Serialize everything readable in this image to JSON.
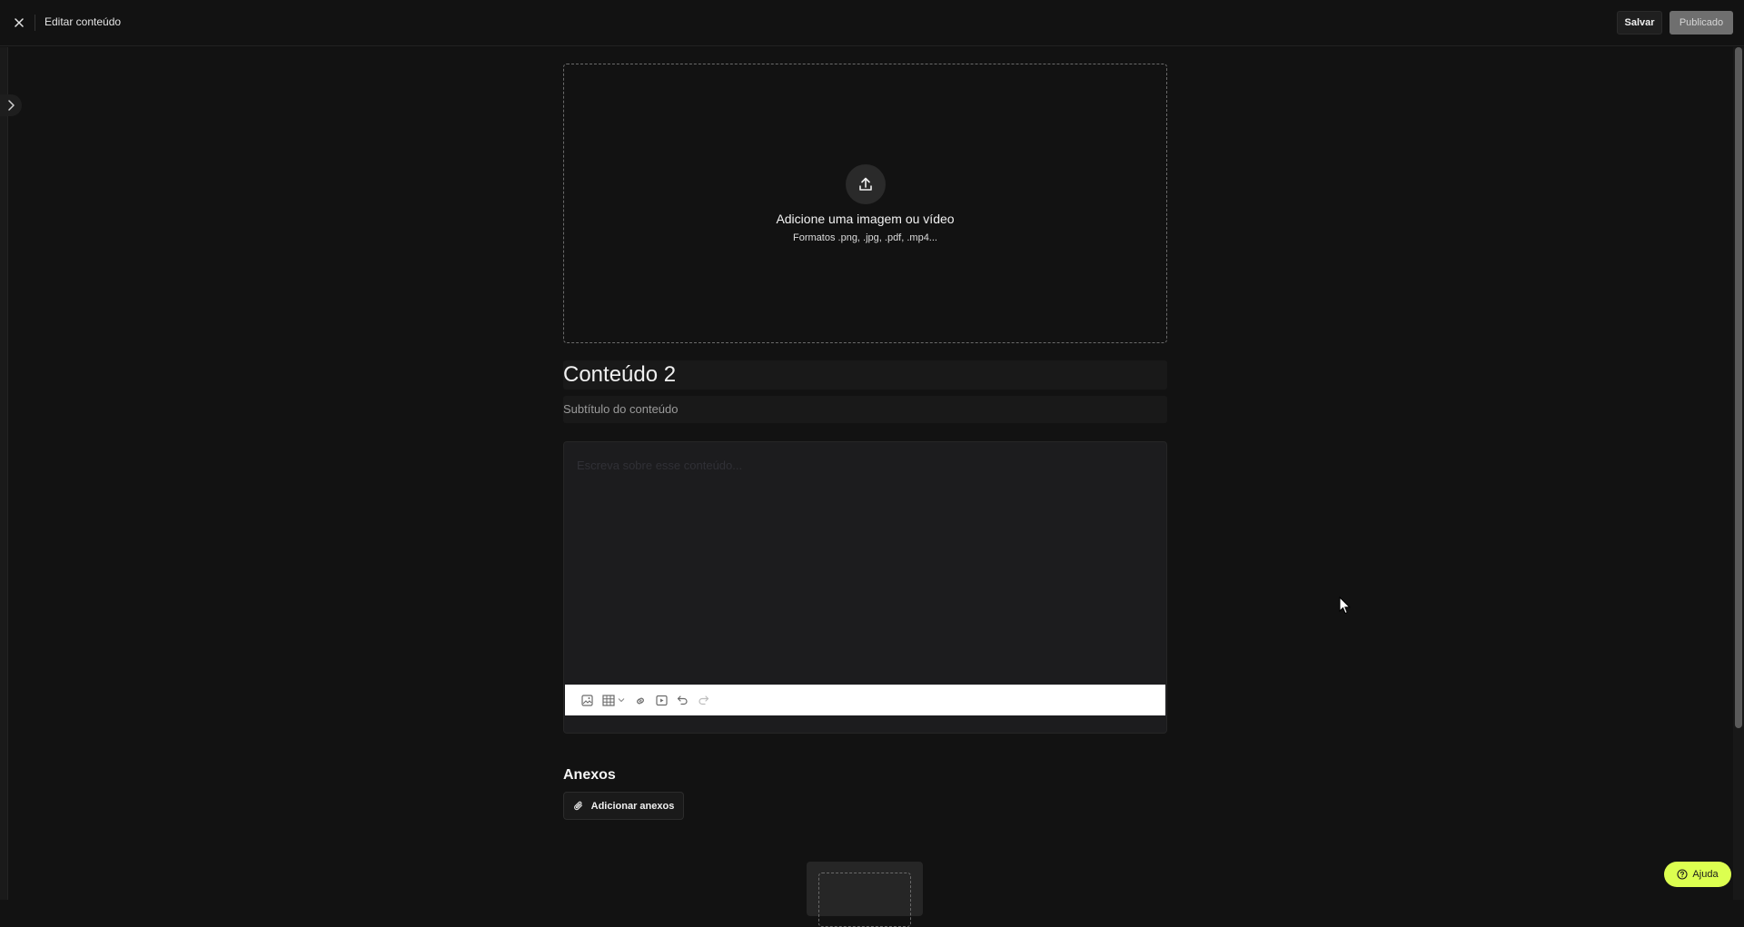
{
  "header": {
    "title": "Editar conteúdo",
    "save_label": "Salvar",
    "publish_status_label": "Publicado"
  },
  "upload": {
    "title": "Adicione uma imagem ou vídeo",
    "formats": "Formatos .png, .jpg, .pdf, .mp4..."
  },
  "content": {
    "title": "Conteúdo 2",
    "subtitle_placeholder": "Subtítulo do conteúdo",
    "body_placeholder": "Escreva sobre esse conteúdo..."
  },
  "editor_toolbar": {
    "tools": [
      "image-icon",
      "table-icon",
      "link-icon",
      "video-icon",
      "undo-icon",
      "redo-icon"
    ]
  },
  "attachments": {
    "heading": "Anexos",
    "add_label": "Adicionar anexos"
  },
  "help": {
    "label": "Ajuda"
  },
  "colors": {
    "background": "#121212",
    "accent_help": "#dcff50",
    "published_button": "#6f6f6f"
  }
}
